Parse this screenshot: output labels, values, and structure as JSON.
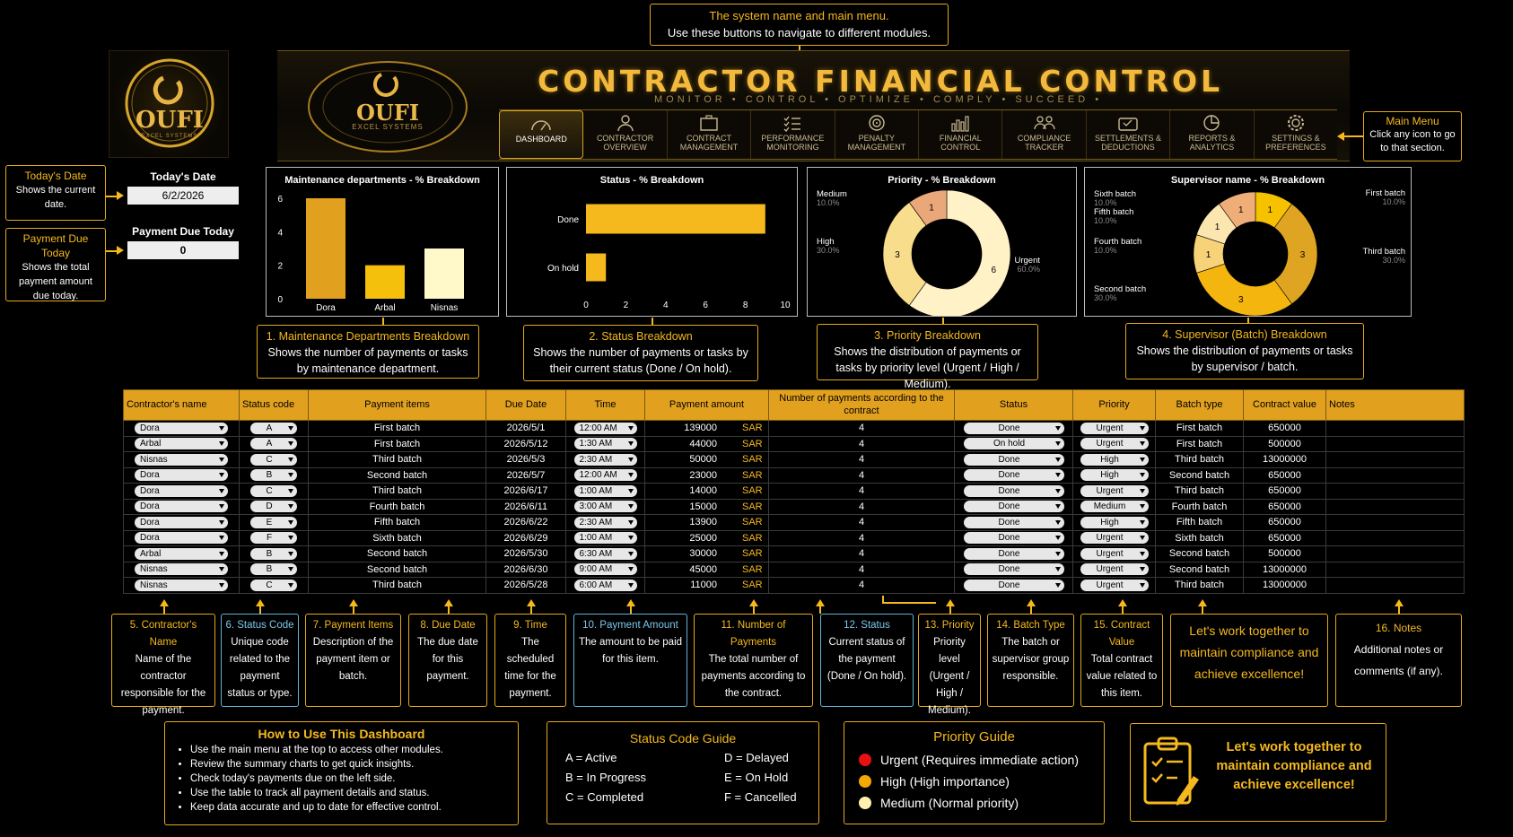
{
  "logo": {
    "text": "OUFI",
    "sub": "EXCEL SYSTEMS"
  },
  "banner": {
    "title": "CONTRACTOR FINANCIAL CONTROL",
    "subtitle": "MONITOR  •  CONTROL  •  OPTIMIZE  •  COMPLY  •  SUCCEED  •",
    "logo_text": "OUFI",
    "logo_sub": "EXCEL SYSTEMS"
  },
  "menu": [
    {
      "label": "DASHBOARD",
      "icon": "gauge-icon"
    },
    {
      "label": "CONTRACTOR OVERVIEW",
      "icon": "user-icon"
    },
    {
      "label": "CONTRACT MANAGEMENT",
      "icon": "briefcase-icon"
    },
    {
      "label": "PERFORMANCE MONITORING",
      "icon": "checklist-icon"
    },
    {
      "label": "PENALTY MANAGEMENT",
      "icon": "target-icon"
    },
    {
      "label": "FINANCIAL CONTROL",
      "icon": "bar-chart-icon"
    },
    {
      "label": "COMPLIANCE TRACKER",
      "icon": "people-icon"
    },
    {
      "label": "SETTLEMENTS & DEDUCTIONS",
      "icon": "wallet-icon"
    },
    {
      "label": "REPORTS & ANALYTICS",
      "icon": "pie-icon"
    },
    {
      "label": "SETTINGS & PREFERENCES",
      "icon": "gear-icon"
    }
  ],
  "callouts": {
    "top": {
      "line1": "The system name and main menu.",
      "line2": "Use these buttons to navigate to different modules."
    },
    "main_menu": {
      "title": "Main Menu",
      "text": "Click any icon to go to that section."
    },
    "today": {
      "title": "Today's Date",
      "text": "Shows the current date."
    },
    "payment": {
      "title": "Payment Due Today",
      "text": "Shows the total payment amount due today."
    },
    "c1": {
      "title": "1. Maintenance Departments Breakdown",
      "text": "Shows the number of payments or tasks by maintenance department."
    },
    "c2": {
      "title": "2. Status Breakdown",
      "text": "Shows the number of payments or tasks by their current status (Done / On hold)."
    },
    "c3": {
      "title": "3. Priority Breakdown",
      "text": "Shows the distribution of payments or tasks by priority level (Urgent / High / Medium)."
    },
    "c4": {
      "title": "4. Supervisor (Batch) Breakdown",
      "text": "Shows the distribution of payments or tasks by supervisor / batch."
    }
  },
  "today_panel": {
    "label": "Today's Date",
    "value": "6/2/2026"
  },
  "payment_panel": {
    "label": "Payment  Due Today",
    "value": "0"
  },
  "chart_data": [
    {
      "type": "bar",
      "title": "Maintenance departments - % Breakdown",
      "categories": [
        "Dora",
        "Arbal",
        "Nisnas"
      ],
      "values": [
        6,
        2,
        3
      ],
      "ylim": [
        0,
        6
      ],
      "yticks": [
        "0",
        "2",
        "4",
        "6"
      ],
      "colors": [
        "#e1a11f",
        "#f5c00c",
        "#fff8c8"
      ]
    },
    {
      "type": "bar",
      "orientation": "horizontal",
      "title": "Status - % Breakdown",
      "categories": [
        "Done",
        "On hold"
      ],
      "values": [
        9,
        1
      ],
      "xlim": [
        0,
        10
      ],
      "xticks": [
        "0",
        "2",
        "4",
        "6",
        "8",
        "10"
      ],
      "color": "#f5b91e"
    },
    {
      "type": "pie",
      "donut": true,
      "title": "Priority - % Breakdown",
      "slices": [
        {
          "label": "Urgent",
          "value": 6,
          "pct": "60.0%",
          "color": "#fff2c6"
        },
        {
          "label": "High",
          "value": 3,
          "pct": "30.0%",
          "color": "#f7dd8c"
        },
        {
          "label": "Medium",
          "value": 1,
          "pct": "10.0%",
          "color": "#eaa77a"
        }
      ]
    },
    {
      "type": "pie",
      "donut": true,
      "title": "Supervisor name - % Breakdown",
      "slices": [
        {
          "label": "First batch",
          "value": 1,
          "pct": "10.0%",
          "color": "#f6c200"
        },
        {
          "label": "Third batch",
          "value": 3,
          "pct": "30.0%",
          "color": "#dfa422"
        },
        {
          "label": "Second batch",
          "value": 3,
          "pct": "30.0%",
          "color": "#f3b50e"
        },
        {
          "label": "Fourth batch",
          "value": 1,
          "pct": "10.0%",
          "color": "#f7d278"
        },
        {
          "label": "Fifth batch",
          "value": 1,
          "pct": "10.0%",
          "color": "#fbe6b0"
        },
        {
          "label": "Sixth batch",
          "value": 1,
          "pct": "10.0%",
          "color": "#efae78"
        }
      ]
    }
  ],
  "table": {
    "headers": [
      "Contractor's name",
      "Status code",
      "Payment items",
      "Due Date",
      "Time",
      "Payment amount",
      "Number of payments according to the contract",
      "Status",
      "Priority",
      "Batch type",
      "Contract value",
      "Notes"
    ],
    "currency": "SAR",
    "rows": [
      [
        "Dora",
        "A",
        "First batch",
        "2026/5/1",
        "12:00 AM",
        "139000",
        "4",
        "Done",
        "Urgent",
        "First batch",
        "650000"
      ],
      [
        "Arbal",
        "A",
        "First batch",
        "2026/5/12",
        "1:30 AM",
        "44000",
        "4",
        "On hold",
        "Urgent",
        "First batch",
        "500000"
      ],
      [
        "Nisnas",
        "C",
        "Third batch",
        "2026/5/3",
        "2:30 AM",
        "50000",
        "4",
        "Done",
        "High",
        "Third batch",
        "13000000"
      ],
      [
        "Dora",
        "B",
        "Second batch",
        "2026/5/7",
        "12:00 AM",
        "23000",
        "4",
        "Done",
        "High",
        "Second batch",
        "650000"
      ],
      [
        "Dora",
        "C",
        "Third batch",
        "2026/6/17",
        "1:00 AM",
        "14000",
        "4",
        "Done",
        "Urgent",
        "Third batch",
        "650000"
      ],
      [
        "Dora",
        "D",
        "Fourth batch",
        "2026/6/11",
        "3:00 AM",
        "15000",
        "4",
        "Done",
        "Medium",
        "Fourth batch",
        "650000"
      ],
      [
        "Dora",
        "E",
        "Fifth batch",
        "2026/6/22",
        "2:30 AM",
        "13900",
        "4",
        "Done",
        "High",
        "Fifth batch",
        "650000"
      ],
      [
        "Dora",
        "F",
        "Sixth batch",
        "2026/6/29",
        "1:00 AM",
        "25000",
        "4",
        "Done",
        "Urgent",
        "Sixth batch",
        "650000"
      ],
      [
        "Arbal",
        "B",
        "Second batch",
        "2026/5/30",
        "6:30 AM",
        "30000",
        "4",
        "Done",
        "Urgent",
        "Second batch",
        "500000"
      ],
      [
        "Nisnas",
        "B",
        "Second batch",
        "2026/6/30",
        "9:00 AM",
        "45000",
        "4",
        "Done",
        "Urgent",
        "Second batch",
        "13000000"
      ],
      [
        "Nisnas",
        "C",
        "Third batch",
        "2026/5/28",
        "6:00 AM",
        "11000",
        "4",
        "Done",
        "Urgent",
        "Third batch",
        "13000000"
      ]
    ]
  },
  "column_notes": [
    {
      "title": "5. Contractor's Name",
      "text": "Name of the contractor responsible for the payment."
    },
    {
      "title": "6. Status Code",
      "text": "Unique code related to the payment status or type."
    },
    {
      "title": "7. Payment Items",
      "text": "Description of the payment item or batch."
    },
    {
      "title": "8. Due Date",
      "text": "The due date for this payment."
    },
    {
      "title": "9. Time",
      "text": "The scheduled time for the payment."
    },
    {
      "title": "10. Payment Amount",
      "text": "The amount to be paid for this item."
    },
    {
      "title": "11. Number of Payments",
      "text": "The total number of payments according to the contract."
    },
    {
      "title": "12. Status",
      "text": "Current status of the payment (Done / On hold)."
    },
    {
      "title": "13. Priority",
      "text": "Priority level (Urgent / High / Medium)."
    },
    {
      "title": "14. Batch Type",
      "text": "The batch or supervisor group responsible."
    },
    {
      "title": "15. Contract Value",
      "text": "Total contract value related to this item."
    },
    {
      "title": "",
      "text": "Let's work together to maintain compliance and achieve excellence!"
    },
    {
      "title": "16. Notes",
      "text": "Additional notes or comments (if any)."
    }
  ],
  "how_to": {
    "title": "How to Use This Dashboard",
    "items": [
      "Use the main menu at the top to access other modules.",
      "Review the summary charts to get quick insights.",
      "Check today's payments due on the left side.",
      "Use the table to track all payment details and status.",
      "Keep data accurate and up to date for effective control."
    ]
  },
  "status_guide": {
    "title": "Status Code Guide",
    "items": [
      "A = Active",
      "D = Delayed",
      "B = In Progress",
      "E = On Hold",
      "C = Completed",
      "F = Cancelled"
    ]
  },
  "priority_guide": {
    "title": "Priority Guide",
    "items": [
      {
        "label": "Urgent (Requires immediate action)",
        "color": "#e81010"
      },
      {
        "label": "High (High importance)",
        "color": "#f2a900"
      },
      {
        "label": "Medium (Normal priority)",
        "color": "#fff0b0"
      }
    ]
  },
  "motto": {
    "text": "Let's work together to maintain compliance and achieve excellence!",
    "icon": "clipboard-icon"
  }
}
